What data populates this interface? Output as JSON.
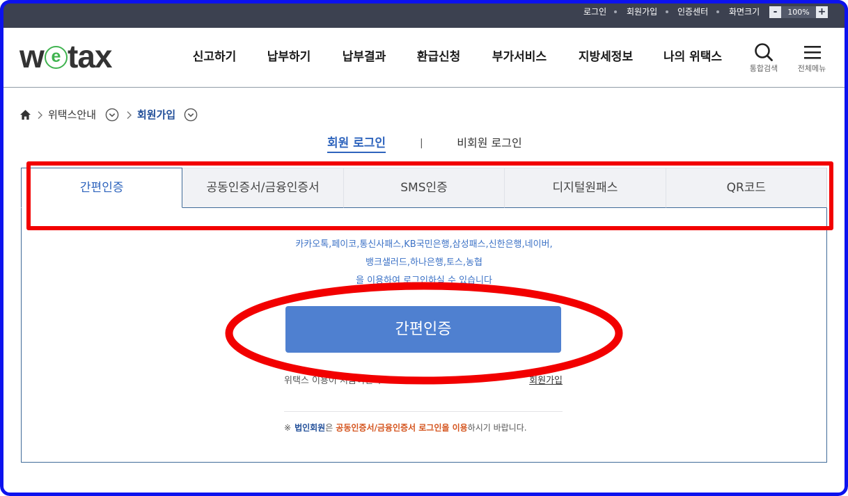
{
  "colors": {
    "topbar": "#3c4150",
    "accent_blue": "#2e64bd",
    "breadcrumb_blue": "#23509a",
    "provider_blue": "#3c72c6",
    "button_blue": "#4f80d0",
    "panel_border": "#3f6a98",
    "notice_orange": "#d4531c",
    "logo_green": "#3fb34f",
    "annotation_red": "#f20000",
    "frame_blue": "#0c12ee"
  },
  "utility_bar": {
    "links": [
      "로그인",
      "회원가입",
      "인증센터"
    ],
    "font_size_label": "화면크기",
    "zoom_out": "-",
    "zoom_level": "100%",
    "zoom_in": "+"
  },
  "logo": {
    "part1": "w",
    "part2": "e",
    "part3": "tax"
  },
  "nav": {
    "items": [
      "신고하기",
      "납부하기",
      "납부결과",
      "환급신청",
      "부가서비스",
      "지방세정보",
      "나의 위택스"
    ]
  },
  "header_tools": {
    "search_icon": "search-icon",
    "search_label": "통합검색",
    "menu_icon": "hamburger-menu-icon",
    "menu_label": "전체메뉴"
  },
  "breadcrumb": {
    "home_icon": "home-icon",
    "separator_icon": "chevron-right-icon",
    "dropdown_icon": "circle-chevron-down-icon",
    "items": [
      "위택스안내",
      "회원가입"
    ]
  },
  "login_type": {
    "active_index": 0,
    "options": [
      "회원 로그인",
      "비회원 로그인"
    ],
    "separator": "|"
  },
  "auth_tabs": {
    "active_index": 0,
    "items": [
      "간편인증",
      "공동인증서/금융인증서",
      "SMS인증",
      "디지털원패스",
      "QR코드"
    ]
  },
  "simple_auth": {
    "providers": [
      "카카오톡,페이코,통신사패스,KB국민은행,삼성패스,신한은행,네이버,",
      "뱅크샐러드,하나은행,토스,농협",
      "을 이용하여 로그인하실 수 있습니다"
    ],
    "button_label": "간편인증",
    "help_text": "위택스 이용이 처음이신가요?",
    "signup_link": "회원가입",
    "notice": {
      "mark": "※",
      "subject": "법인회원",
      "particle": "은",
      "highlight": "공동인증서/금융인증서 로그인을 이용",
      "tail": "하시기 바랍니다."
    }
  }
}
